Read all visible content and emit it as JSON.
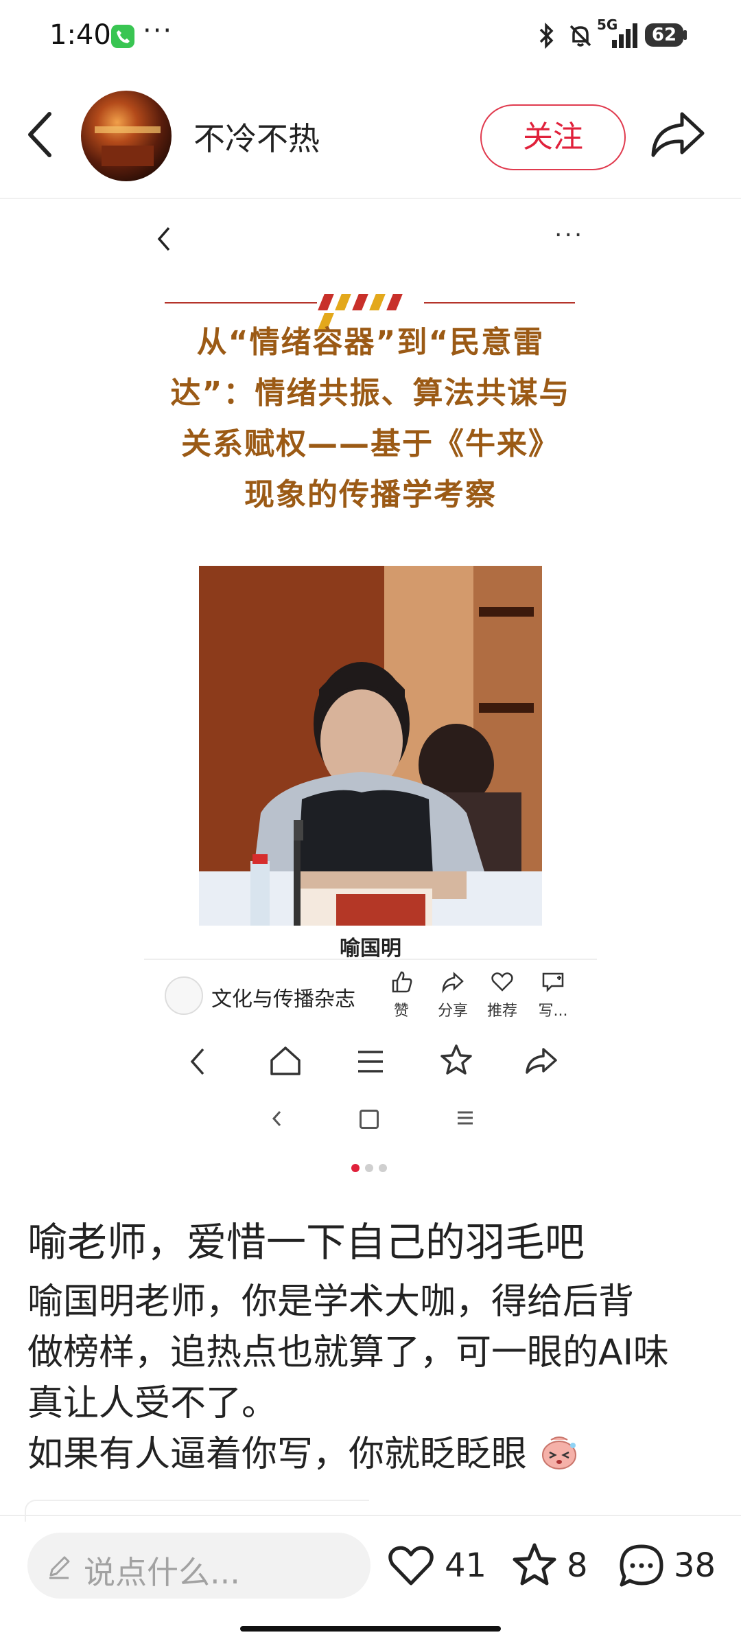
{
  "status_bar": {
    "time": "1:40",
    "more": "···",
    "network": "5G",
    "battery": "62"
  },
  "header": {
    "author": "不冷不热",
    "follow_label": "关注"
  },
  "inner_article": {
    "more": "···",
    "title_lines": [
      "从“情绪容器”到“民意雷",
      "达”：情绪共振、算法共谋与",
      "关系赋权——基于《牛来》",
      "现象的传播学考察"
    ],
    "stripe_colors": [
      "#c8302a",
      "#e3a81b",
      "#c8302a",
      "#e3a81b",
      "#c8302a",
      "#e3a81b"
    ],
    "photo_caption": "喻国明",
    "magazine_name": "文化与传播杂志",
    "actions": [
      {
        "icon": "thumbs-up-icon",
        "label": "赞"
      },
      {
        "icon": "share-icon",
        "label": "分享"
      },
      {
        "icon": "heart-icon",
        "label": "推荐"
      },
      {
        "icon": "comment-icon",
        "label": "写..."
      }
    ]
  },
  "post": {
    "title": "喻老师，爱惜一下自己的羽毛吧",
    "body_lines": [
      "喻国明老师，你是学术大咖，得给后背",
      "做榜样，追热点也就算了，可一眼的AI味",
      "真让人受不了。",
      "如果有人逼着你写，你就眨眨眼"
    ]
  },
  "bottom_bar": {
    "comment_placeholder": "说点什么...",
    "like_count": "41",
    "favorite_count": "8",
    "comment_count": "38"
  },
  "colors": {
    "accent_red": "#e0213b",
    "title_brown": "#9b5a15"
  }
}
